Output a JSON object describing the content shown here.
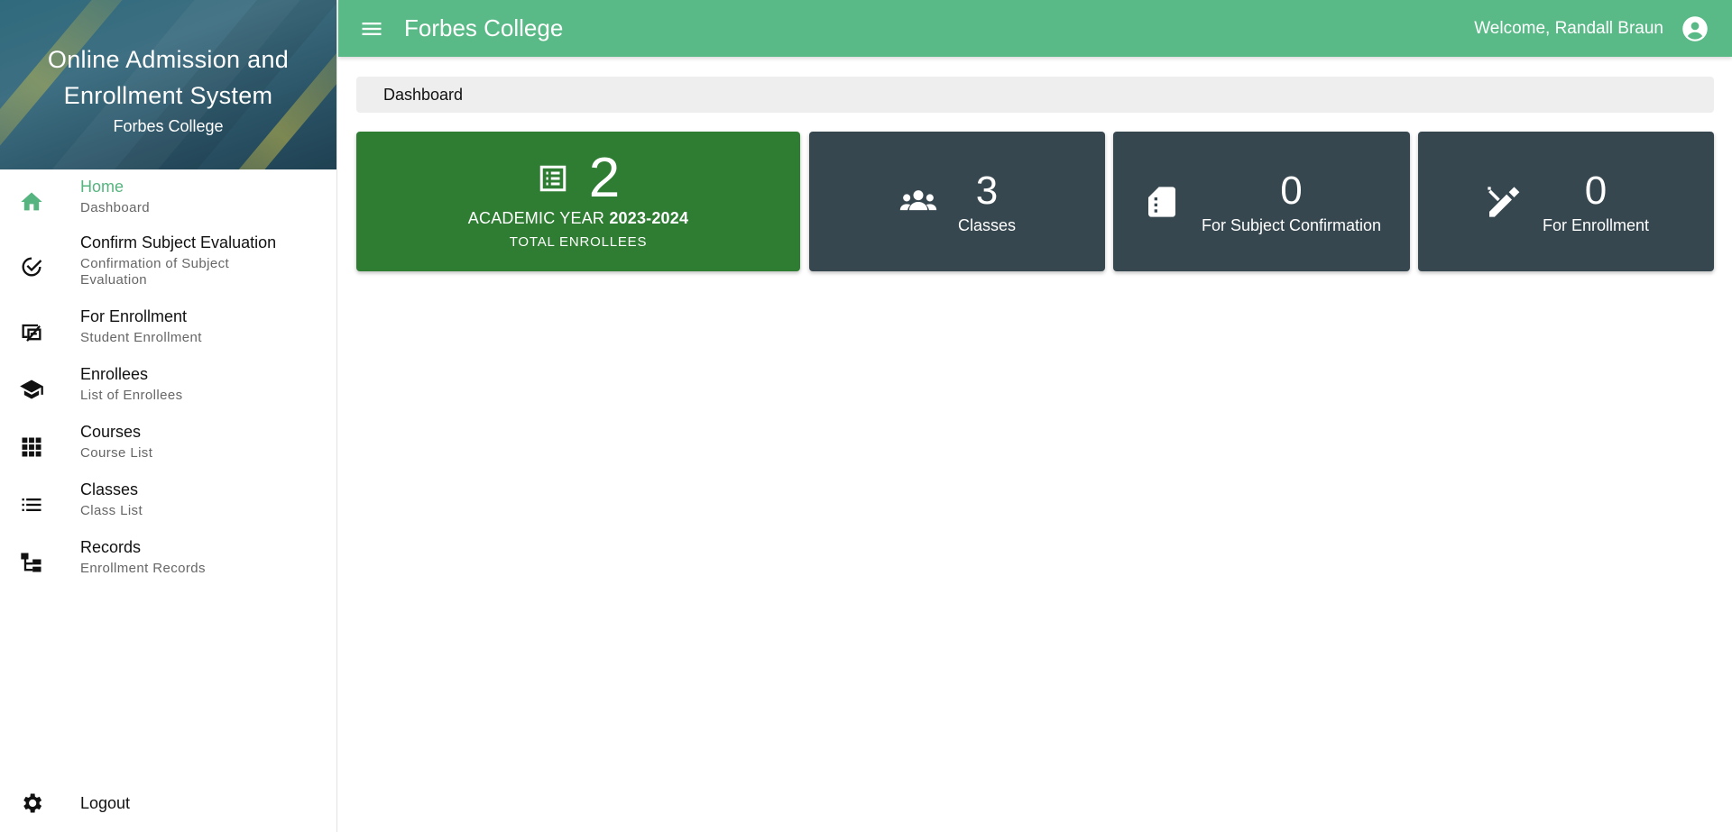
{
  "sidebar": {
    "title": "Online Admission and Enrollment System",
    "subtitle": "Forbes College",
    "items": [
      {
        "label": "Home",
        "desc": "Dashboard",
        "icon": "home-icon"
      },
      {
        "label": "Confirm Subject Evaluation",
        "desc": "Confirmation of Subject Evaluation",
        "icon": "check-circle-icon"
      },
      {
        "label": "For Enrollment",
        "desc": "Student Enrollment",
        "icon": "enrollment-icon"
      },
      {
        "label": "Enrollees",
        "desc": "List of Enrollees",
        "icon": "graduation-cap-icon"
      },
      {
        "label": "Courses",
        "desc": "Course List",
        "icon": "grid-icon"
      },
      {
        "label": "Classes",
        "desc": "Class List",
        "icon": "list-icon"
      },
      {
        "label": "Records",
        "desc": "Enrollment Records",
        "icon": "hierarchy-icon"
      }
    ],
    "logout_label": "Logout"
  },
  "topbar": {
    "title": "Forbes College",
    "welcome": "Welcome, Randall Braun"
  },
  "breadcrumb": "Dashboard",
  "cards": {
    "total": {
      "value": "2",
      "year_prefix": "ACADEMIC YEAR",
      "year": "2023-2024",
      "label": "TOTAL ENROLLEES"
    },
    "classes": {
      "value": "3",
      "label": "Classes"
    },
    "subject_confirmation": {
      "value": "0",
      "label": "For Subject Confirmation"
    },
    "enrollment": {
      "value": "0",
      "label": "For Enrollment"
    }
  },
  "colors": {
    "accent": "#5aba87",
    "green_card": "#2e7d32",
    "dark_card": "#37474f"
  }
}
